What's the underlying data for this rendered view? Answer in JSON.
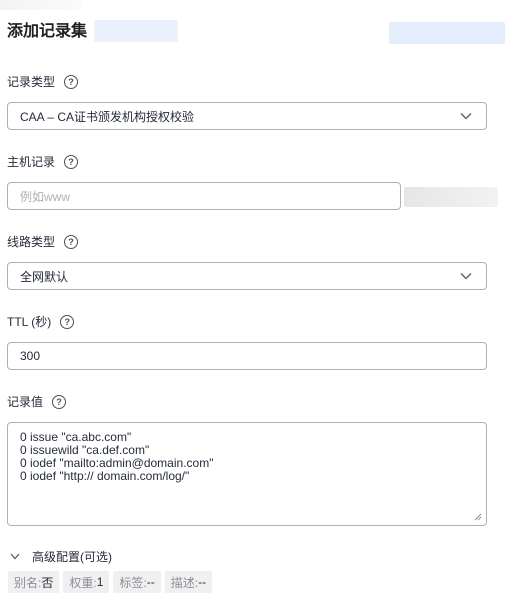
{
  "header": {
    "title": "添加记录集"
  },
  "record_type": {
    "label": "记录类型",
    "help_icon": "question-circle-icon",
    "value": "CAA – CA证书颁发机构授权校验"
  },
  "host_record": {
    "label": "主机记录",
    "help_icon": "question-circle-icon",
    "placeholder": "例如www"
  },
  "line_type": {
    "label": "线路类型",
    "help_icon": "question-circle-icon",
    "value": "全网默认"
  },
  "ttl": {
    "label": "TTL (秒)",
    "help_icon": "question-circle-icon",
    "value": "300"
  },
  "record_value": {
    "label": "记录值",
    "help_icon": "question-circle-icon",
    "lines": [
      "0 issue \"ca.abc.com\"",
      "0 issuewild \"ca.def.com\"",
      "0 iodef \"mailto:admin@domain.com\"",
      "0 iodef \"http:// domain.com/log/\""
    ]
  },
  "advanced": {
    "label": "高级配置(可选)",
    "tags": [
      {
        "key": "别名:",
        "value": "否"
      },
      {
        "key": "权重:",
        "value": "1"
      },
      {
        "key": "标签:",
        "value": "--"
      },
      {
        "key": "描述:",
        "value": "--"
      }
    ]
  }
}
